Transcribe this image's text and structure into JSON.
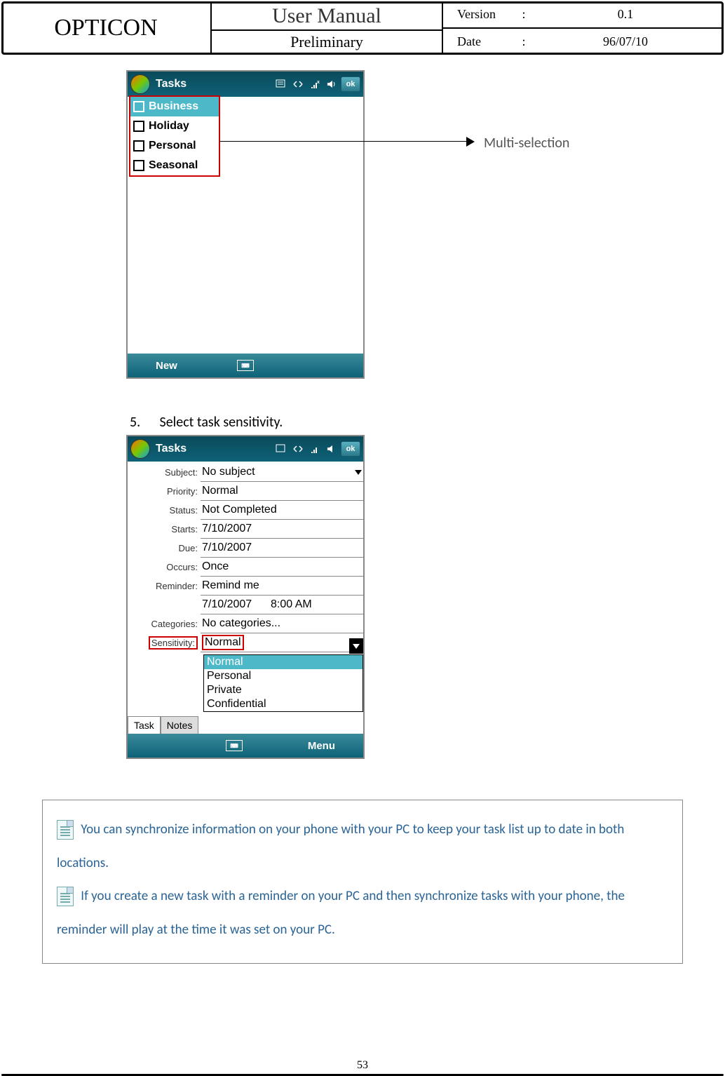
{
  "header": {
    "brand": "OPTICON",
    "title": "User Manual",
    "subtitle": "Preliminary",
    "version_label": "Version",
    "version_value": "0.1",
    "date_label": "Date",
    "date_value": "96/07/10"
  },
  "screenshot1": {
    "title": "Tasks",
    "ok": "ok",
    "categories": [
      "Business",
      "Holiday",
      "Personal",
      "Seasonal"
    ],
    "bottom_new": "New"
  },
  "arrow_label": "Multi-selection",
  "step": {
    "num": "5.",
    "text": "Select task sensitivity."
  },
  "screenshot2": {
    "title": "Tasks",
    "ok": "ok",
    "fields": {
      "subject": {
        "label": "Subject:",
        "value": "No subject"
      },
      "priority": {
        "label": "Priority:",
        "value": "Normal"
      },
      "status": {
        "label": "Status:",
        "value": "Not Completed"
      },
      "starts": {
        "label": "Starts:",
        "value": "7/10/2007"
      },
      "due": {
        "label": "Due:",
        "value": "7/10/2007"
      },
      "occurs": {
        "label": "Occurs:",
        "value": "Once"
      },
      "reminder": {
        "label": "Reminder:",
        "value": "Remind me",
        "date": "7/10/2007",
        "time": "8:00 AM"
      },
      "categories": {
        "label": "Categories:",
        "value": "No categories..."
      },
      "sensitivity": {
        "label": "Sensitivity:",
        "value": "Normal"
      }
    },
    "sens_options": [
      "Normal",
      "Personal",
      "Private",
      "Confidential"
    ],
    "tabs": [
      "Task",
      "Notes"
    ],
    "bottom_menu": "Menu"
  },
  "notes": {
    "n1": "You can synchronize information on your phone with your PC to keep your task list up to date in both locations.",
    "n2": "If you create a new task with a reminder on your PC and then synchronize tasks with your phone, the reminder will play at the time it was set on your PC."
  },
  "page_number": "53"
}
